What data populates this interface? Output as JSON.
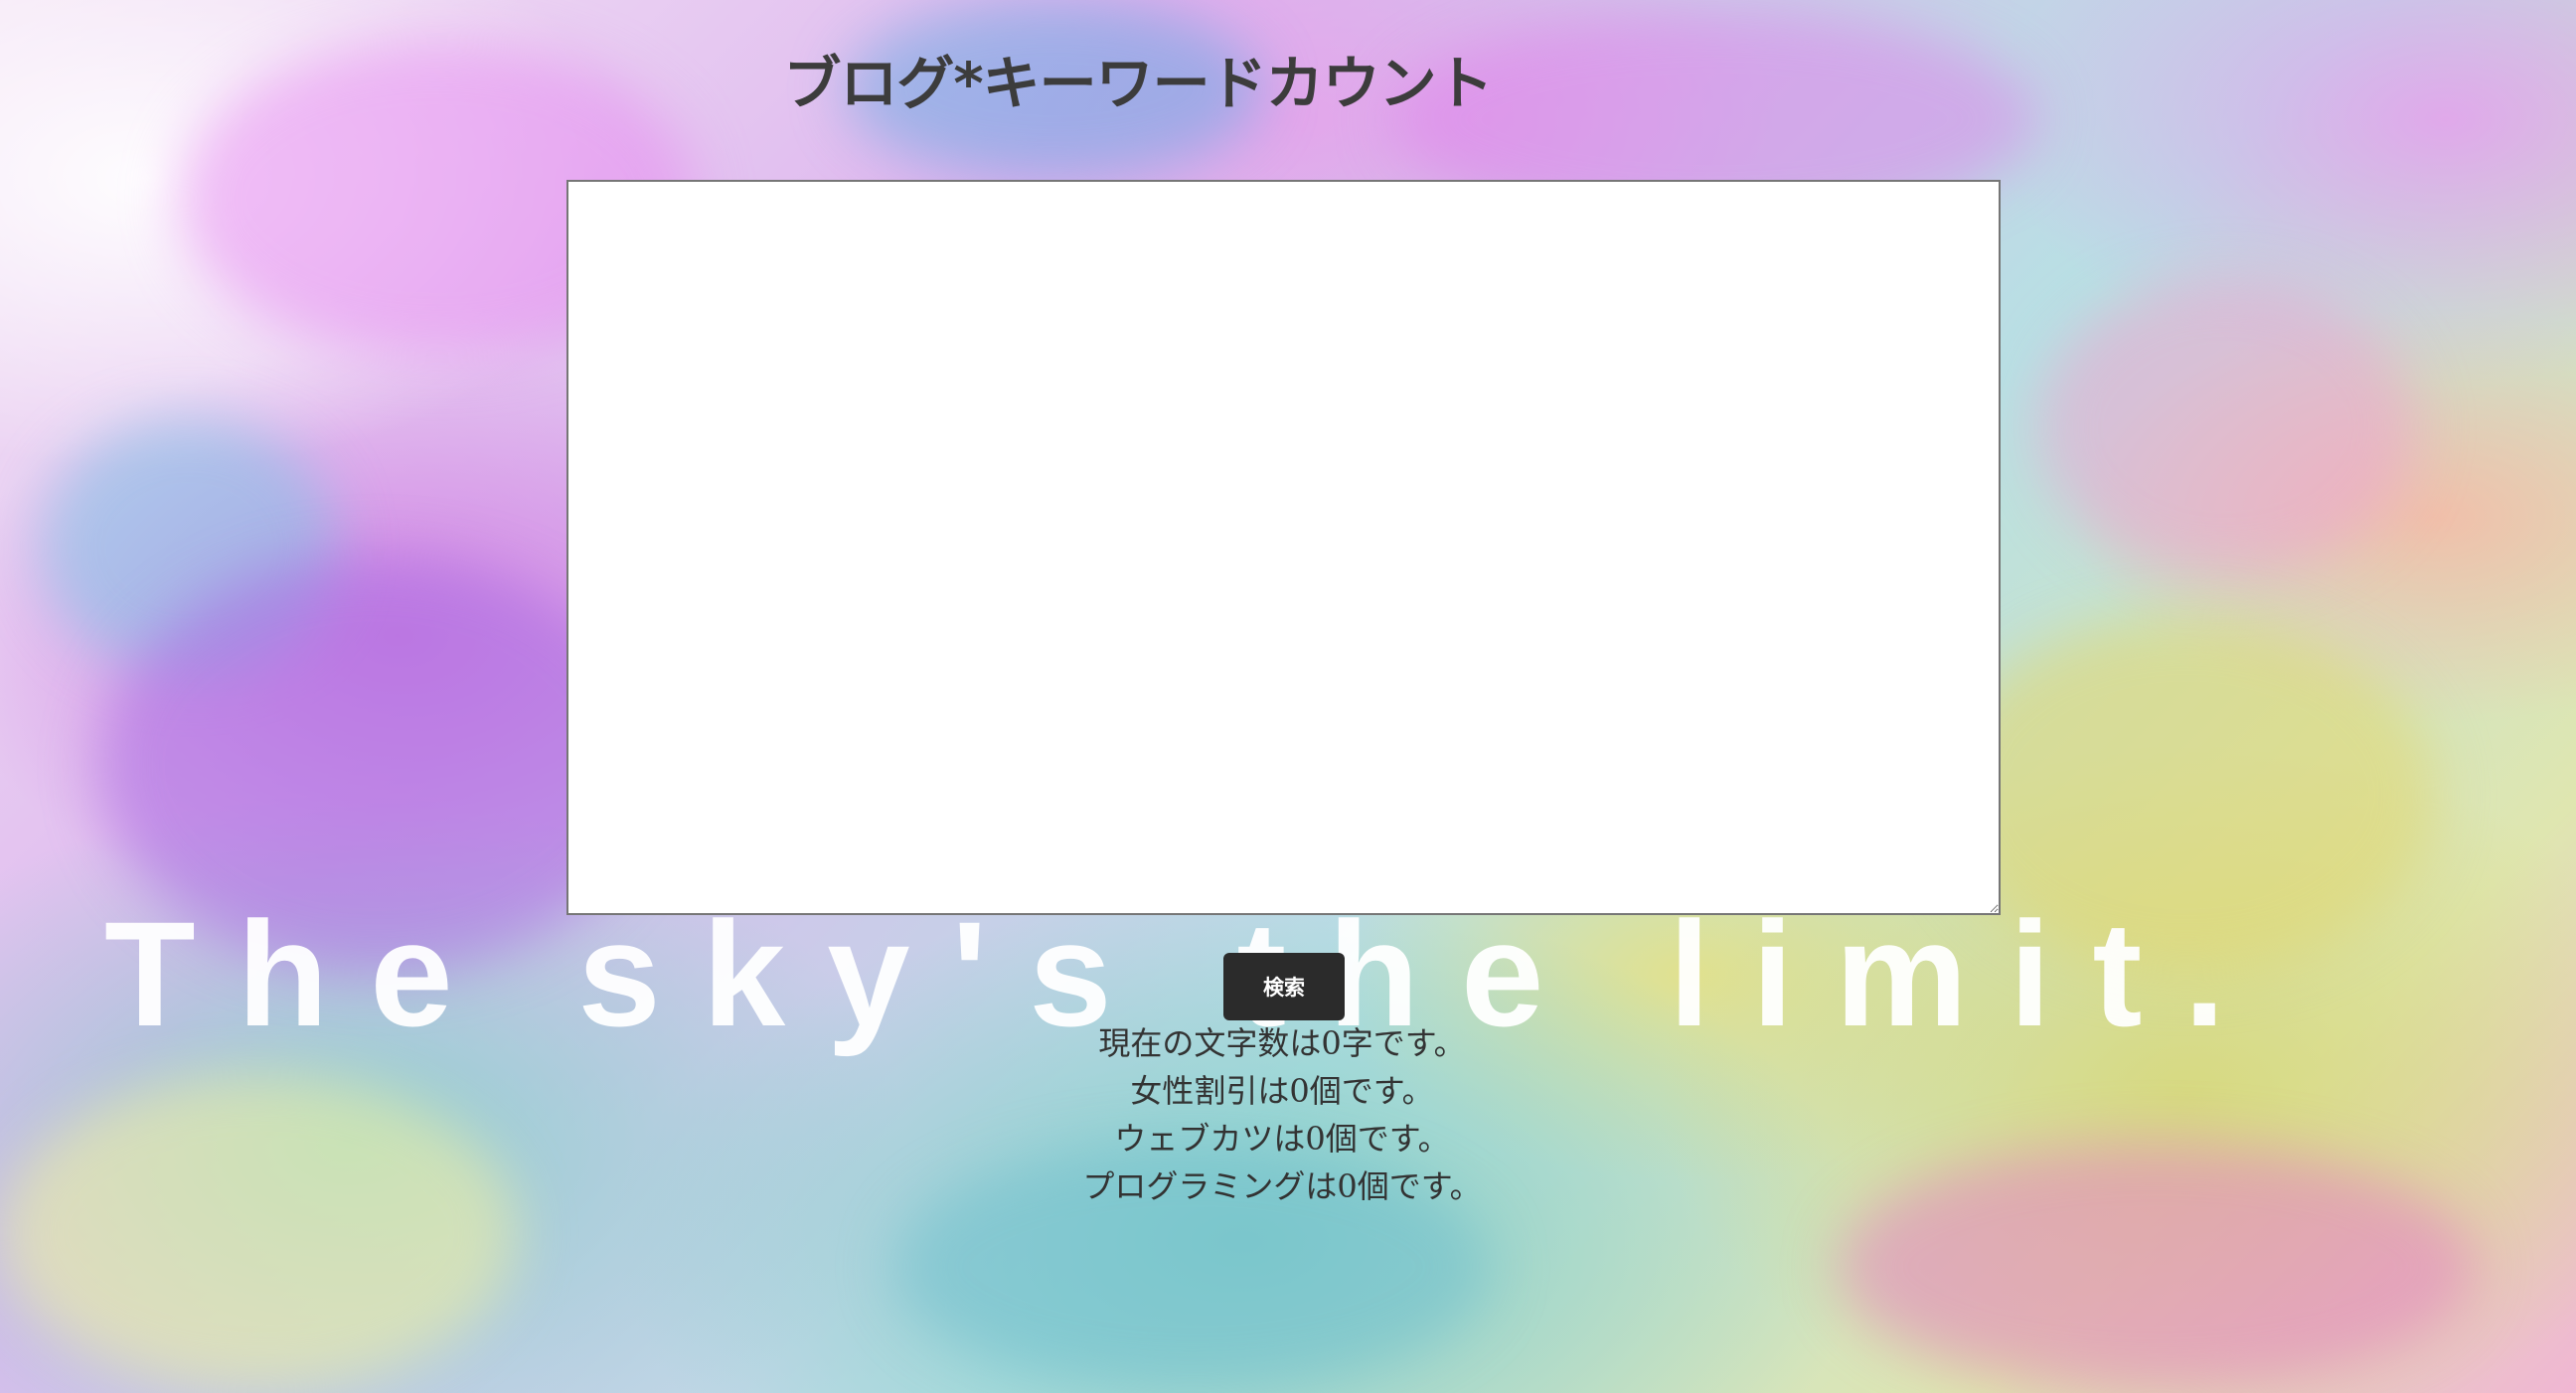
{
  "page": {
    "title": "ブログ*キーワードカウント",
    "slogan": "The sky's the limit."
  },
  "input": {
    "value": ""
  },
  "actions": {
    "search_label": "検索"
  },
  "results": {
    "char_count": "現在の文字数は0字です。",
    "keyword_1": "女性割引は0個です。",
    "keyword_2": "ウェブカツは0個です。",
    "keyword_3": "プログラミングは0個です。"
  }
}
